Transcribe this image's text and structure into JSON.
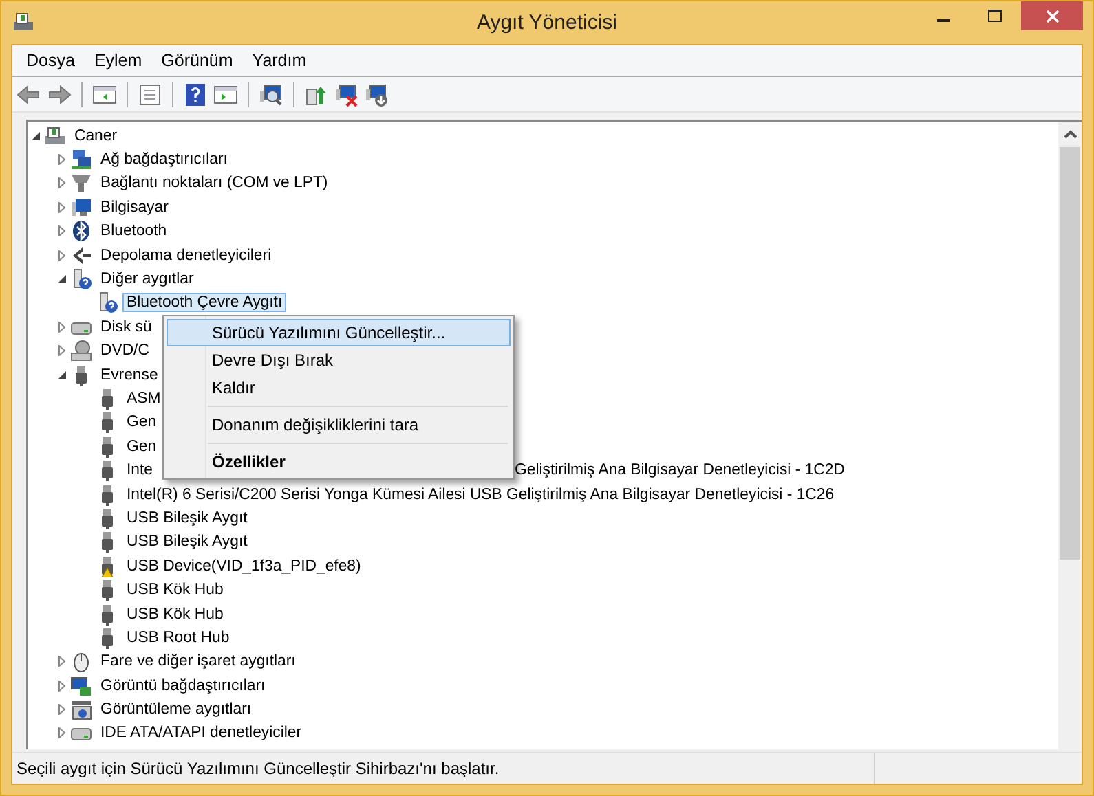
{
  "window": {
    "title": "Aygıt Yöneticisi"
  },
  "menu_bar": [
    "Dosya",
    "Eylem",
    "Görünüm",
    "Yardım"
  ],
  "tree": [
    {
      "label": "Caner",
      "kind": "computer",
      "expanded": true,
      "children": [
        {
          "label": "Ağ bağdaştırıcıları",
          "kind": "network",
          "expanded": false
        },
        {
          "label": "Bağlantı noktaları (COM ve LPT)",
          "kind": "port",
          "expanded": false
        },
        {
          "label": "Bilgisayar",
          "kind": "monitor",
          "expanded": false
        },
        {
          "label": "Bluetooth",
          "kind": "bluetooth",
          "expanded": false
        },
        {
          "label": "Depolama denetleyicileri",
          "kind": "storage",
          "expanded": false
        },
        {
          "label": "Diğer aygıtlar",
          "kind": "unknown",
          "expanded": true,
          "children": [
            {
              "label": "Bluetooth Çevre Aygıtı",
              "kind": "unknown",
              "selected": true
            }
          ]
        },
        {
          "label": "Disk sü",
          "kind": "disk",
          "expanded": false
        },
        {
          "label": "DVD/C",
          "kind": "dvd",
          "expanded": false
        },
        {
          "label": "Evrense",
          "kind": "usb",
          "expanded": true,
          "children": [
            {
              "label": "ASM",
              "kind": "usb",
              "selected": false
            },
            {
              "label": "Gen",
              "kind": "usb",
              "selected": false
            },
            {
              "label": "Gen",
              "kind": "usb",
              "selected": false
            },
            {
              "label": "Inte",
              "tail": "Geliştirilmiş Ana Bilgisayar Denetleyicisi - 1C2D",
              "kind": "usb",
              "selected": false
            },
            {
              "label": "Intel(R) 6 Serisi/C200 Serisi Yonga Kümesi Ailesi USB Geliştirilmiş Ana Bilgisayar Denetleyicisi - 1C26",
              "kind": "usb",
              "selected": false
            },
            {
              "label": "USB Bileşik Aygıt",
              "kind": "usb",
              "selected": false
            },
            {
              "label": "USB Bileşik Aygıt",
              "kind": "usb",
              "selected": false
            },
            {
              "label": "USB Device(VID_1f3a_PID_efe8)",
              "kind": "usb",
              "warning": true,
              "selected": false
            },
            {
              "label": "USB Kök Hub",
              "kind": "usb",
              "selected": false
            },
            {
              "label": "USB Kök Hub",
              "kind": "usb",
              "selected": false
            },
            {
              "label": "USB Root Hub",
              "kind": "usb",
              "selected": false
            }
          ]
        },
        {
          "label": "Fare ve diğer işaret aygıtları",
          "kind": "mouse",
          "expanded": false
        },
        {
          "label": "Görüntü bağdaştırıcıları",
          "kind": "display",
          "expanded": false
        },
        {
          "label": "Görüntüleme aygıtları",
          "kind": "camera",
          "expanded": false
        },
        {
          "label": "IDE ATA/ATAPI denetleyiciler",
          "kind": "disk",
          "expanded": false
        }
      ]
    }
  ],
  "context_menu": [
    {
      "kind": "item",
      "label": "Sürücü Yazılımını Güncelleştir...",
      "selected": true,
      "default": false
    },
    {
      "kind": "item",
      "label": "Devre Dışı Bırak",
      "selected": false,
      "default": false
    },
    {
      "kind": "item",
      "label": "Kaldır",
      "selected": false,
      "default": false
    },
    {
      "kind": "separator"
    },
    {
      "kind": "item",
      "label": "Donanım değişikliklerini tara",
      "selected": false,
      "default": false
    },
    {
      "kind": "separator"
    },
    {
      "kind": "item",
      "label": "Özellikler",
      "selected": false,
      "default": true
    }
  ],
  "status_bar": {
    "text": "Seçili aygıt için Sürücü Yazılımını Güncelleştir Sihirbazı'nı başlatır."
  }
}
